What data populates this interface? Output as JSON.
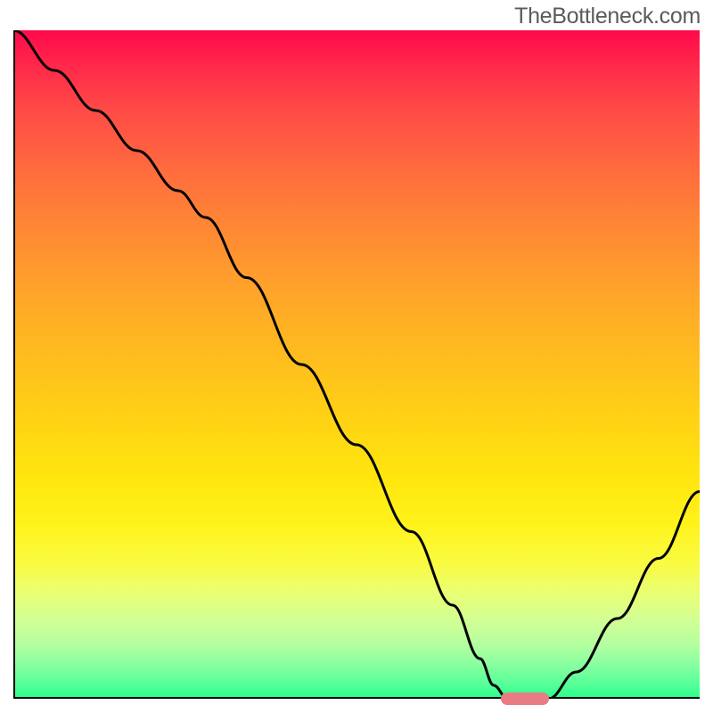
{
  "watermark": "TheBottleneck.com",
  "chart_data": {
    "type": "line",
    "title": "",
    "xlabel": "",
    "ylabel": "",
    "xlim": [
      0,
      100
    ],
    "ylim": [
      0,
      100
    ],
    "legend": false,
    "background": {
      "gradient_stops": [
        {
          "pos": 0,
          "color": "#ff0a4b"
        },
        {
          "pos": 20,
          "color": "#ff683f"
        },
        {
          "pos": 40,
          "color": "#ffa828"
        },
        {
          "pos": 60,
          "color": "#ffd613"
        },
        {
          "pos": 80,
          "color": "#f9fb44"
        },
        {
          "pos": 95,
          "color": "#86ffa0"
        },
        {
          "pos": 100,
          "color": "#26ff8a"
        }
      ]
    },
    "series": [
      {
        "name": "bottleneck-curve",
        "x": [
          0,
          6,
          12,
          18,
          24,
          28,
          34,
          42,
          50,
          58,
          64,
          68,
          70,
          72,
          76,
          78,
          82,
          88,
          94,
          100
        ],
        "y": [
          100,
          94,
          88,
          82,
          76,
          72,
          63,
          50,
          38,
          25,
          14,
          6,
          2,
          0,
          0,
          0,
          4,
          12,
          21,
          31
        ]
      }
    ],
    "marker": {
      "name": "sweet-spot",
      "x_start": 71,
      "x_end": 78,
      "y": 0,
      "color": "#e97b84"
    }
  }
}
